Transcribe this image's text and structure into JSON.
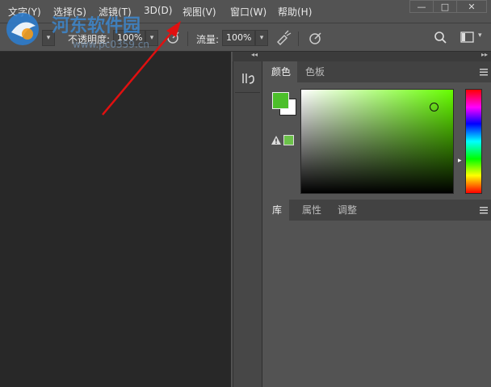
{
  "menu": [
    "文字(Y)",
    "选择(S)",
    "滤镜(T)",
    "3D(D)",
    "视图(V)",
    "窗口(W)",
    "帮助(H)"
  ],
  "window_controls": {
    "minimize": "—",
    "restore": "□",
    "close": "✕"
  },
  "watermark": {
    "line1": "河东软件园",
    "line2": "www.pc0359.cn"
  },
  "options": {
    "opacity_label": "不透明度:",
    "opacity_value": "100%",
    "flow_label": "流量:",
    "flow_value": "100%"
  },
  "color_panel": {
    "tabs": [
      "颜色",
      "色板"
    ],
    "active_tab": "颜色",
    "foreground_color": "#4cbf2a",
    "background_color": "#ffffff",
    "websafe_swatch": "#6cc24a",
    "field_hue": "#66ff00"
  },
  "lower_panel": {
    "tabs": [
      "库",
      "属性",
      "调整"
    ],
    "active_tab": "库"
  },
  "collapse_glyph": "◂◂",
  "icons": [
    "search-icon",
    "workspace-icon",
    "chevron-down-icon",
    "airbrush-icon",
    "pressure-icon",
    "panel-menu-icon",
    "history-icon",
    "gamut-warning-icon"
  ],
  "colors": {
    "arrow": "#e01010",
    "canvas": "#282828",
    "panel": "#535353"
  }
}
